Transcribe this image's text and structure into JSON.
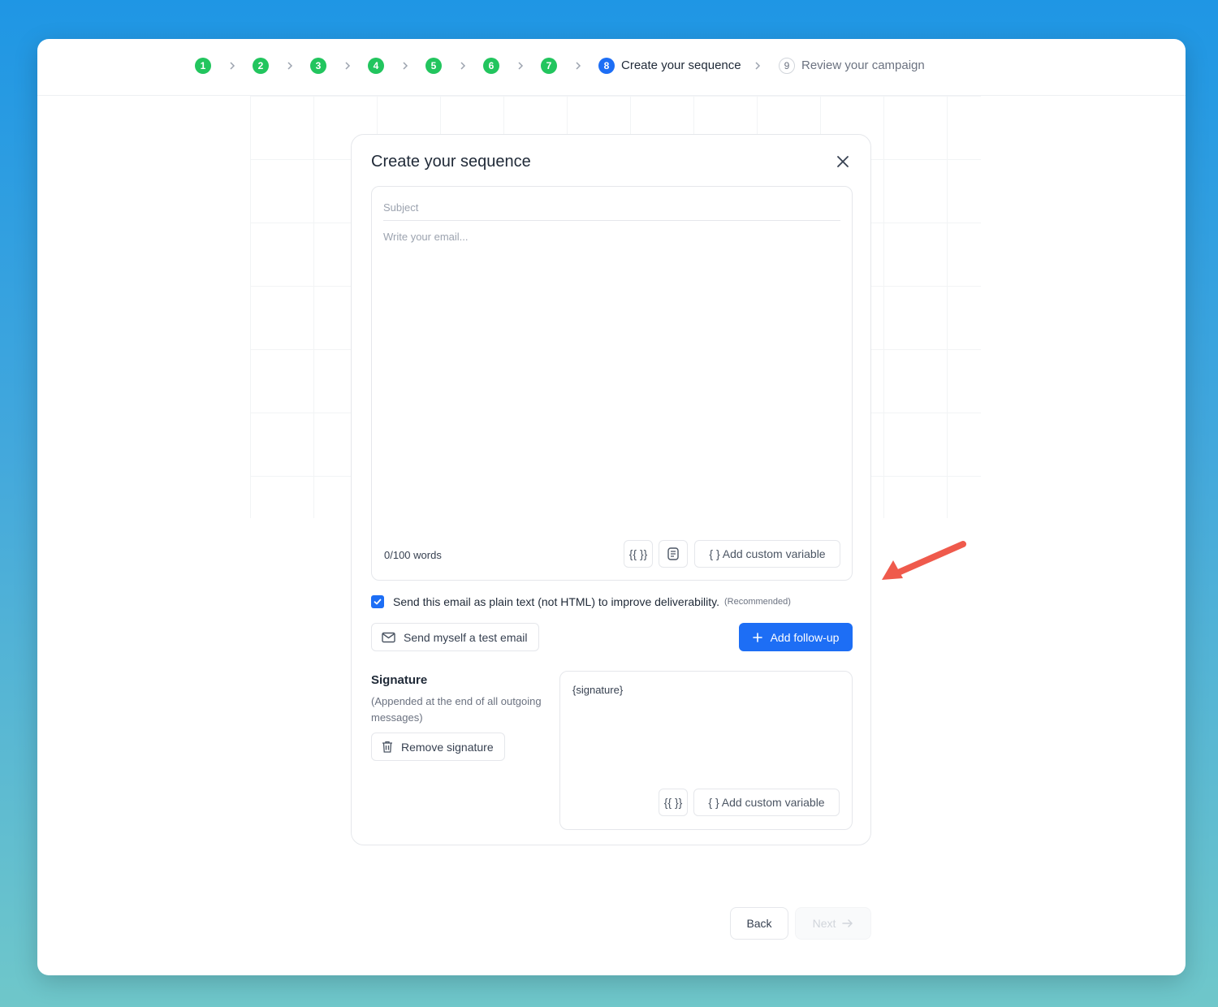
{
  "stepper": {
    "steps": [
      {
        "number": "1",
        "state": "done"
      },
      {
        "number": "2",
        "state": "done"
      },
      {
        "number": "3",
        "state": "done"
      },
      {
        "number": "4",
        "state": "done"
      },
      {
        "number": "5",
        "state": "done"
      },
      {
        "number": "6",
        "state": "done"
      },
      {
        "number": "7",
        "state": "done"
      },
      {
        "number": "8",
        "state": "active",
        "label": "Create your sequence"
      },
      {
        "number": "9",
        "state": "pending",
        "label": "Review your campaign"
      }
    ]
  },
  "modal": {
    "title": "Create your sequence",
    "subject_placeholder": "Subject",
    "body_placeholder": "Write your email...",
    "word_count": "0/100 words",
    "variable_button_label": "{{ }}",
    "add_custom_variable_label": "{ } Add custom variable",
    "plain_text_label": "Send this email as plain text (not HTML) to improve deliverability.",
    "plain_text_recommended": "(Recommended)",
    "plain_text_checked": true,
    "test_email_label": "Send myself a test email",
    "add_followup_label": "Add follow-up",
    "signature": {
      "title": "Signature",
      "description": "(Appended at the end of all outgoing messages)",
      "remove_label": "Remove signature",
      "value": "{signature}",
      "variable_button_label": "{{ }}",
      "add_custom_variable_label": "{ } Add custom variable"
    }
  },
  "footer": {
    "back_label": "Back",
    "next_label": "Next"
  },
  "colors": {
    "step_done": "#22c55e",
    "step_active": "#1d6ef5",
    "primary": "#1d6ef5",
    "annotation_arrow": "#ef5a4c"
  }
}
